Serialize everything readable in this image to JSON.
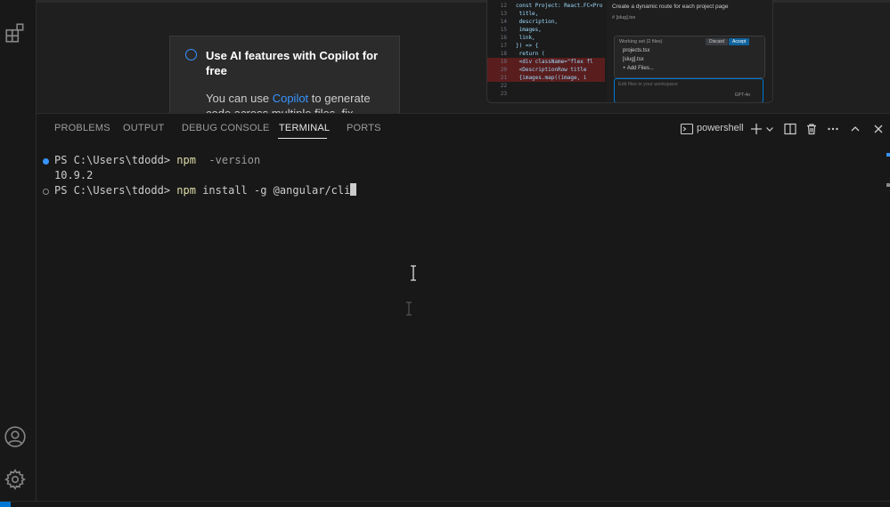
{
  "activity_bar": {
    "icons": [
      "extensions-icon",
      "account-icon",
      "settings-gear-icon"
    ]
  },
  "walkthrough": {
    "title": "Use AI features with Copilot for free",
    "body_prefix": "You can use ",
    "link_text": "Copilot",
    "body_suffix": " to generate code across multiple files, fix"
  },
  "preview": {
    "code_lines": [
      {
        "n": "12",
        "text": "const Project: React.FC<Pro"
      },
      {
        "n": "13",
        "text": "  title,"
      },
      {
        "n": "14",
        "text": "  description,"
      },
      {
        "n": "15",
        "text": "  images,"
      },
      {
        "n": "16",
        "text": "  link,"
      },
      {
        "n": "17",
        "text": "}) => {"
      },
      {
        "n": "18",
        "text": "  return ("
      },
      {
        "n": "19",
        "text": "    <div className=\"flex fl"
      },
      {
        "n": "20",
        "text": "      <DescriptionRow title"
      },
      {
        "n": "21",
        "text": "      {images.map((image, i"
      },
      {
        "n": "22",
        "text": ""
      },
      {
        "n": "23",
        "text": ""
      }
    ],
    "chat_prompt": "Create a dynamic route for each project page",
    "chat_chip": "# [slug].tsx",
    "working_set_label": "Working set (2 files)",
    "discard_label": "Discard",
    "accept_label": "Accept",
    "files": [
      "projects.tsx",
      "[slug].tsx",
      "+ Add Files..."
    ],
    "input_placeholder": "Edit files in your workspace",
    "model": "GPT-4o"
  },
  "panel": {
    "tabs": [
      "PROBLEMS",
      "OUTPUT",
      "DEBUG CONSOLE",
      "TERMINAL",
      "PORTS"
    ],
    "active_tab": "TERMINAL",
    "shell_name": "powershell"
  },
  "terminal": {
    "line1_prompt": "PS C:\\Users\\tdodd> ",
    "line1_cmd": "npm",
    "line1_args": "  -version",
    "line2_output": "10.9.2",
    "line3_prompt": "PS C:\\Users\\tdodd> ",
    "line3_cmd": "npm",
    "line3_args": " install -g @angular/cli"
  },
  "colors": {
    "accent": "#3794ff",
    "background": "#181818",
    "command": "#dcdcaa"
  }
}
